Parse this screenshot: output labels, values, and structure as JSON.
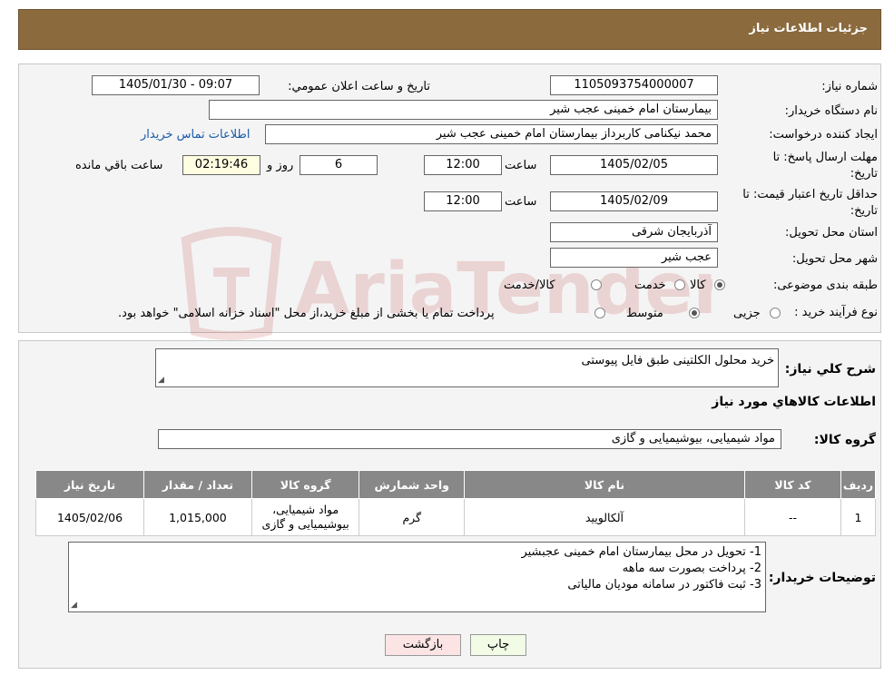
{
  "header": {
    "title": "جزئیات اطلاعات نیاز"
  },
  "form": {
    "need_number_label": "شماره نیاز:",
    "need_number": "1105093754000007",
    "announce_label": "تاریخ و ساعت اعلان عمومي:",
    "announce_value": "1405/01/30 - 09:07",
    "buyer_org_label": "نام دستگاه خریدار:",
    "buyer_org": "بیمارستان امام خمینی عجب شیر",
    "requester_label": "ایجاد کننده درخواست:",
    "requester": "محمد نیکنامی کاربرداز بیمارستان امام خمینی عجب شیر",
    "contact_link": "اطلاعات تماس خریدار",
    "deadline_label_1": "مهلت ارسال پاسخ: تا",
    "deadline_label_2": "تاریخ:",
    "deadline_date": "1405/02/05",
    "time_label": "ساعت",
    "deadline_time": "12:00",
    "days_value": "6",
    "days_label": "روز و",
    "remaining_time": "02:19:46",
    "remaining_label": "ساعت باقي مانده",
    "validity_label_1": "حداقل تاریخ اعتبار قیمت: تا",
    "validity_label_2": "تاریخ:",
    "validity_date": "1405/02/09",
    "validity_time": "12:00",
    "province_label": "استان محل تحویل:",
    "province": "آذربایجان شرقی",
    "city_label": "شهر محل تحویل:",
    "city": "عجب شیر",
    "category_label": "طبقه بندی موضوعی:",
    "category_options": [
      "کالا",
      "خدمت",
      "کالا/خدمت"
    ],
    "process_label": "نوع فرآیند خرید :",
    "process_options": [
      "جزیی",
      "متوسط"
    ],
    "process_note": "پرداخت تمام یا بخشی از مبلغ خرید،از محل \"اسناد خزانه اسلامی\" خواهد بود."
  },
  "details": {
    "summary_label": "شرح کلي نیاز:",
    "summary": "خرید محلول الکلتینی طبق فایل پیوستی",
    "goods_title": "اطلاعات کالاهاي مورد نیاز",
    "group_label": "گروه کالا:",
    "group": "مواد شیمیایی، بیوشیمیایی و  گازی"
  },
  "table": {
    "headers": [
      "ردیف",
      "کد کالا",
      "نام کالا",
      "واحد شمارش",
      "گروه کالا",
      "تعداد / مقدار",
      "تاریخ نیاز"
    ],
    "rows": [
      {
        "row": "1",
        "code": "--",
        "name": "آلکالویید",
        "unit": "گرم",
        "group_line1": "مواد شیمیایی،",
        "group_line2": "بیوشیمیایی و گازی",
        "qty": "1,015,000",
        "date": "1405/02/06"
      }
    ]
  },
  "buyer_notes": {
    "label": "توضیحات خریدار:",
    "lines": [
      "1- تحویل در محل بیمارستان امام خمینی عجبشیر",
      "2- پرداخت بصورت سه ماهه",
      "3- ثبت فاکتور در سامانه مودیان مالیاتی"
    ]
  },
  "buttons": {
    "print": "چاپ",
    "back": "بازگشت"
  },
  "watermark": {
    "text": "AriaTender.neT"
  }
}
